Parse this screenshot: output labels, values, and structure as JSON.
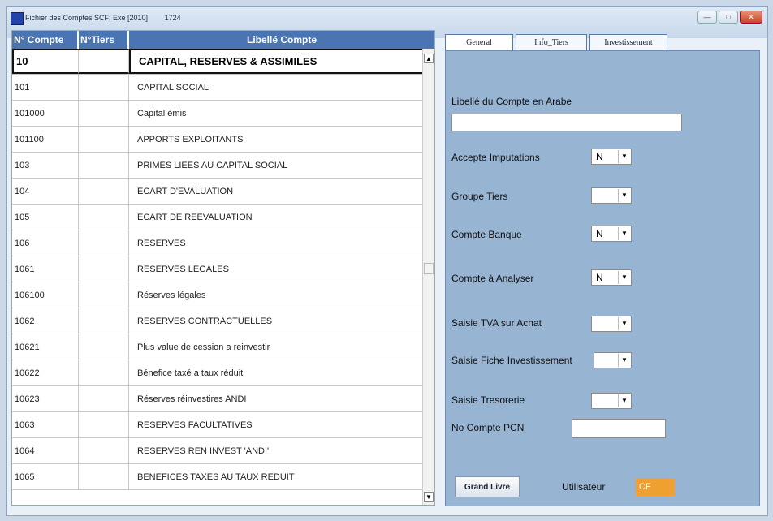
{
  "window": {
    "title": "Fichier des Comptes SCF: Exe [2010]",
    "title_code": "1724"
  },
  "grid": {
    "headers": [
      "N° Compte",
      "N°Tiers",
      "Libellé Compte"
    ],
    "rows": [
      {
        "compte": "10",
        "tiers": "",
        "libelle": "CAPITAL, RESERVES & ASSIMILES"
      },
      {
        "compte": "101",
        "tiers": "",
        "libelle": "CAPITAL SOCIAL"
      },
      {
        "compte": "101000",
        "tiers": "",
        "libelle": "Capital émis"
      },
      {
        "compte": "101100",
        "tiers": "",
        "libelle": "APPORTS EXPLOITANTS"
      },
      {
        "compte": "103",
        "tiers": "",
        "libelle": "PRIMES LIEES AU CAPITAL SOCIAL"
      },
      {
        "compte": "104",
        "tiers": "",
        "libelle": "ECART D'EVALUATION"
      },
      {
        "compte": "105",
        "tiers": "",
        "libelle": "ECART DE REEVALUATION"
      },
      {
        "compte": "106",
        "tiers": "",
        "libelle": "RESERVES"
      },
      {
        "compte": "1061",
        "tiers": "",
        "libelle": "RESERVES LEGALES"
      },
      {
        "compte": "106100",
        "tiers": "",
        "libelle": "Réserves légales"
      },
      {
        "compte": "1062",
        "tiers": "",
        "libelle": "RESERVES CONTRACTUELLES"
      },
      {
        "compte": "10621",
        "tiers": "",
        "libelle": "Plus value de cession a reinvestir"
      },
      {
        "compte": "10622",
        "tiers": "",
        "libelle": "Bénefice taxé a taux réduit"
      },
      {
        "compte": "10623",
        "tiers": "",
        "libelle": "Réserves réinvestires ANDI"
      },
      {
        "compte": "1063",
        "tiers": "",
        "libelle": "RESERVES FACULTATIVES"
      },
      {
        "compte": "1064",
        "tiers": "",
        "libelle": "RESERVES REN INVEST 'ANDI'"
      },
      {
        "compte": "1065",
        "tiers": "",
        "libelle": "BENEFICES TAXES AU TAUX REDUIT"
      }
    ]
  },
  "tabs": [
    "General",
    "Info_Tiers",
    "Investissement"
  ],
  "form": {
    "libelle_arabe_label": "Libellé du Compte en Arabe",
    "libelle_arabe_value": "",
    "accepte_imputations_label": "Accepte Imputations",
    "accepte_imputations_value": "N",
    "groupe_tiers_label": "Groupe Tiers",
    "groupe_tiers_value": "",
    "compte_banque_label": "Compte Banque",
    "compte_banque_value": "N",
    "compte_analyser_label": "Compte à Analyser",
    "compte_analyser_value": "N",
    "saisie_tva_label": "Saisie TVA sur Achat",
    "saisie_tva_value": "",
    "saisie_fiche_label": "Saisie Fiche Investissement",
    "saisie_fiche_value": "",
    "saisie_tresorerie_label": "Saisie Tresorerie",
    "saisie_tresorerie_value": "",
    "no_compte_pcn_label": "No Compte PCN",
    "no_compte_pcn_value": ""
  },
  "footer": {
    "grand_livre_label": "Grand Livre",
    "utilisateur_label": "Utilisateur",
    "utilisateur_value": "CF"
  }
}
